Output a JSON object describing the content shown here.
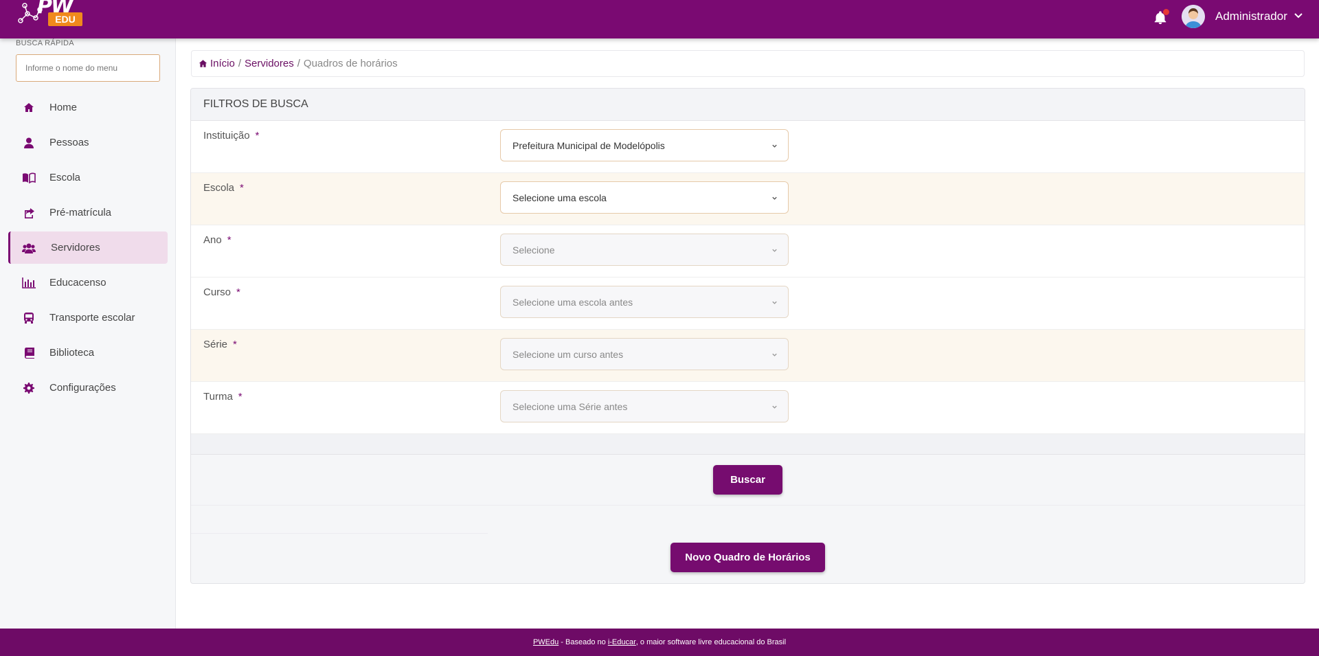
{
  "header": {
    "logo_pw": "PW",
    "logo_edu": "EDU",
    "user_name": "Administrador",
    "icons": [
      "network-logo-icon",
      "bell-icon",
      "avatar",
      "chevron-down-icon"
    ]
  },
  "sidebar": {
    "quick_search_label": "BUSCA RÁPIDA",
    "quick_search_placeholder": "Informe o nome do menu",
    "items": [
      {
        "label": "Home",
        "icon": "home-icon"
      },
      {
        "label": "Pessoas",
        "icon": "user-icon"
      },
      {
        "label": "Escola",
        "icon": "book-open-icon"
      },
      {
        "label": "Pré-matrícula",
        "icon": "share-icon"
      },
      {
        "label": "Servidores",
        "icon": "users-icon",
        "active": true
      },
      {
        "label": "Educacenso",
        "icon": "bar-chart-icon"
      },
      {
        "label": "Transporte escolar",
        "icon": "bus-icon"
      },
      {
        "label": "Biblioteca",
        "icon": "book-icon"
      },
      {
        "label": "Configurações",
        "icon": "gear-icon"
      }
    ]
  },
  "breadcrumb": {
    "home": "Início",
    "sep": "/",
    "section": "Servidores",
    "current": "Quadros de horários"
  },
  "filters": {
    "title": "FILTROS DE BUSCA",
    "required_mark": "*",
    "fields": [
      {
        "label": "Instituição",
        "value": "Prefeitura Municipal de Modelópolis",
        "disabled": false
      },
      {
        "label": "Escola",
        "value": "Selecione uma escola",
        "disabled": false
      },
      {
        "label": "Ano",
        "value": "Selecione",
        "disabled": true
      },
      {
        "label": "Curso",
        "value": "Selecione uma escola antes",
        "disabled": true
      },
      {
        "label": "Série",
        "value": "Selecione um curso antes",
        "disabled": true
      },
      {
        "label": "Turma",
        "value": "Selecione uma Série antes",
        "disabled": true
      }
    ],
    "search_button": "Buscar",
    "new_button": "Novo Quadro de Horários"
  },
  "footer": {
    "brand": "PWEdu",
    "text1": " - Baseado no ",
    "link": "i-Educar",
    "text2": ", o maior software livre educacional do Brasil"
  },
  "colors": {
    "primary": "#7a0a72",
    "accent_orange": "#f08a1c",
    "alt_row": "#fcf7ee"
  }
}
